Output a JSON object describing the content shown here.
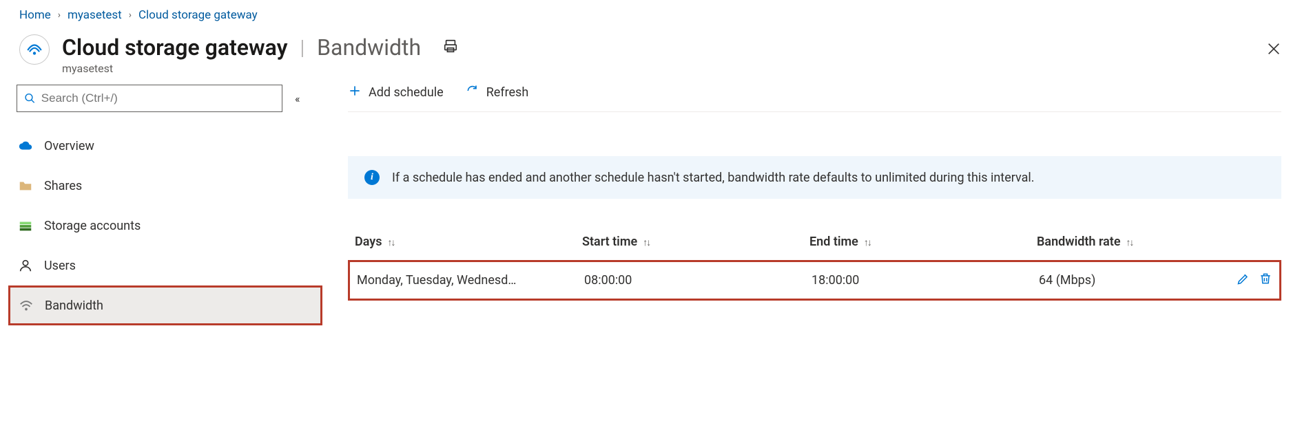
{
  "breadcrumb": {
    "items": [
      {
        "label": "Home"
      },
      {
        "label": "myasetest"
      },
      {
        "label": "Cloud storage gateway"
      }
    ]
  },
  "header": {
    "title": "Cloud storage gateway",
    "subtitle": "Bandwidth",
    "resource_name": "myasetest"
  },
  "search": {
    "placeholder": "Search (Ctrl+/)"
  },
  "sidebar": {
    "items": [
      {
        "id": "overview",
        "label": "Overview"
      },
      {
        "id": "shares",
        "label": "Shares"
      },
      {
        "id": "storage-accounts",
        "label": "Storage accounts"
      },
      {
        "id": "users",
        "label": "Users"
      },
      {
        "id": "bandwidth",
        "label": "Bandwidth",
        "selected": true
      }
    ]
  },
  "toolbar": {
    "add_schedule_label": "Add schedule",
    "refresh_label": "Refresh"
  },
  "info_banner": {
    "text": "If a schedule has ended and another schedule hasn't started, bandwidth rate defaults to unlimited during this interval."
  },
  "table": {
    "columns": {
      "days": "Days",
      "start_time": "Start time",
      "end_time": "End time",
      "bandwidth_rate": "Bandwidth rate"
    },
    "rows": [
      {
        "days": "Monday, Tuesday, Wednesd…",
        "start_time": "08:00:00",
        "end_time": "18:00:00",
        "bandwidth_rate": "64 (Mbps)"
      }
    ]
  }
}
